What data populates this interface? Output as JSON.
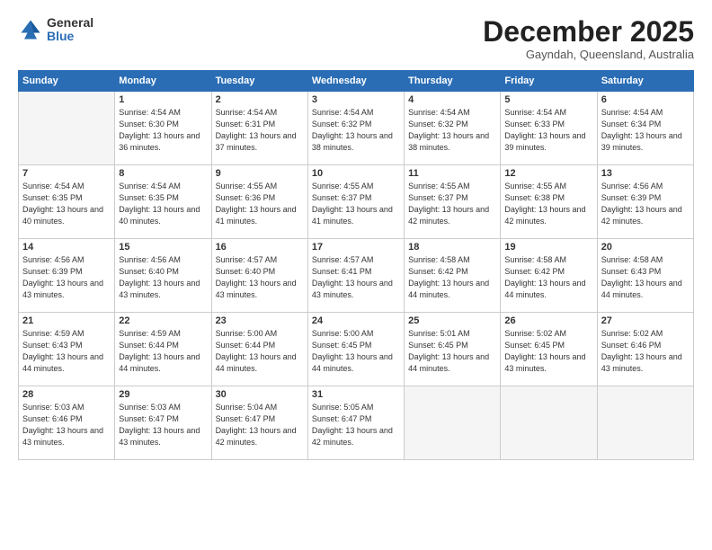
{
  "logo": {
    "general": "General",
    "blue": "Blue"
  },
  "header": {
    "month": "December 2025",
    "location": "Gayndah, Queensland, Australia"
  },
  "weekdays": [
    "Sunday",
    "Monday",
    "Tuesday",
    "Wednesday",
    "Thursday",
    "Friday",
    "Saturday"
  ],
  "weeks": [
    [
      {
        "day": "",
        "empty": true
      },
      {
        "day": "1",
        "sunrise": "4:54 AM",
        "sunset": "6:30 PM",
        "daylight": "13 hours and 36 minutes."
      },
      {
        "day": "2",
        "sunrise": "4:54 AM",
        "sunset": "6:31 PM",
        "daylight": "13 hours and 37 minutes."
      },
      {
        "day": "3",
        "sunrise": "4:54 AM",
        "sunset": "6:32 PM",
        "daylight": "13 hours and 38 minutes."
      },
      {
        "day": "4",
        "sunrise": "4:54 AM",
        "sunset": "6:32 PM",
        "daylight": "13 hours and 38 minutes."
      },
      {
        "day": "5",
        "sunrise": "4:54 AM",
        "sunset": "6:33 PM",
        "daylight": "13 hours and 39 minutes."
      },
      {
        "day": "6",
        "sunrise": "4:54 AM",
        "sunset": "6:34 PM",
        "daylight": "13 hours and 39 minutes."
      }
    ],
    [
      {
        "day": "7",
        "sunrise": "4:54 AM",
        "sunset": "6:35 PM",
        "daylight": "13 hours and 40 minutes."
      },
      {
        "day": "8",
        "sunrise": "4:54 AM",
        "sunset": "6:35 PM",
        "daylight": "13 hours and 40 minutes."
      },
      {
        "day": "9",
        "sunrise": "4:55 AM",
        "sunset": "6:36 PM",
        "daylight": "13 hours and 41 minutes."
      },
      {
        "day": "10",
        "sunrise": "4:55 AM",
        "sunset": "6:37 PM",
        "daylight": "13 hours and 41 minutes."
      },
      {
        "day": "11",
        "sunrise": "4:55 AM",
        "sunset": "6:37 PM",
        "daylight": "13 hours and 42 minutes."
      },
      {
        "day": "12",
        "sunrise": "4:55 AM",
        "sunset": "6:38 PM",
        "daylight": "13 hours and 42 minutes."
      },
      {
        "day": "13",
        "sunrise": "4:56 AM",
        "sunset": "6:39 PM",
        "daylight": "13 hours and 42 minutes."
      }
    ],
    [
      {
        "day": "14",
        "sunrise": "4:56 AM",
        "sunset": "6:39 PM",
        "daylight": "13 hours and 43 minutes."
      },
      {
        "day": "15",
        "sunrise": "4:56 AM",
        "sunset": "6:40 PM",
        "daylight": "13 hours and 43 minutes."
      },
      {
        "day": "16",
        "sunrise": "4:57 AM",
        "sunset": "6:40 PM",
        "daylight": "13 hours and 43 minutes."
      },
      {
        "day": "17",
        "sunrise": "4:57 AM",
        "sunset": "6:41 PM",
        "daylight": "13 hours and 43 minutes."
      },
      {
        "day": "18",
        "sunrise": "4:58 AM",
        "sunset": "6:42 PM",
        "daylight": "13 hours and 44 minutes."
      },
      {
        "day": "19",
        "sunrise": "4:58 AM",
        "sunset": "6:42 PM",
        "daylight": "13 hours and 44 minutes."
      },
      {
        "day": "20",
        "sunrise": "4:58 AM",
        "sunset": "6:43 PM",
        "daylight": "13 hours and 44 minutes."
      }
    ],
    [
      {
        "day": "21",
        "sunrise": "4:59 AM",
        "sunset": "6:43 PM",
        "daylight": "13 hours and 44 minutes."
      },
      {
        "day": "22",
        "sunrise": "4:59 AM",
        "sunset": "6:44 PM",
        "daylight": "13 hours and 44 minutes."
      },
      {
        "day": "23",
        "sunrise": "5:00 AM",
        "sunset": "6:44 PM",
        "daylight": "13 hours and 44 minutes."
      },
      {
        "day": "24",
        "sunrise": "5:00 AM",
        "sunset": "6:45 PM",
        "daylight": "13 hours and 44 minutes."
      },
      {
        "day": "25",
        "sunrise": "5:01 AM",
        "sunset": "6:45 PM",
        "daylight": "13 hours and 44 minutes."
      },
      {
        "day": "26",
        "sunrise": "5:02 AM",
        "sunset": "6:45 PM",
        "daylight": "13 hours and 43 minutes."
      },
      {
        "day": "27",
        "sunrise": "5:02 AM",
        "sunset": "6:46 PM",
        "daylight": "13 hours and 43 minutes."
      }
    ],
    [
      {
        "day": "28",
        "sunrise": "5:03 AM",
        "sunset": "6:46 PM",
        "daylight": "13 hours and 43 minutes."
      },
      {
        "day": "29",
        "sunrise": "5:03 AM",
        "sunset": "6:47 PM",
        "daylight": "13 hours and 43 minutes."
      },
      {
        "day": "30",
        "sunrise": "5:04 AM",
        "sunset": "6:47 PM",
        "daylight": "13 hours and 42 minutes."
      },
      {
        "day": "31",
        "sunrise": "5:05 AM",
        "sunset": "6:47 PM",
        "daylight": "13 hours and 42 minutes."
      },
      {
        "day": "",
        "empty": true
      },
      {
        "day": "",
        "empty": true
      },
      {
        "day": "",
        "empty": true
      }
    ]
  ]
}
